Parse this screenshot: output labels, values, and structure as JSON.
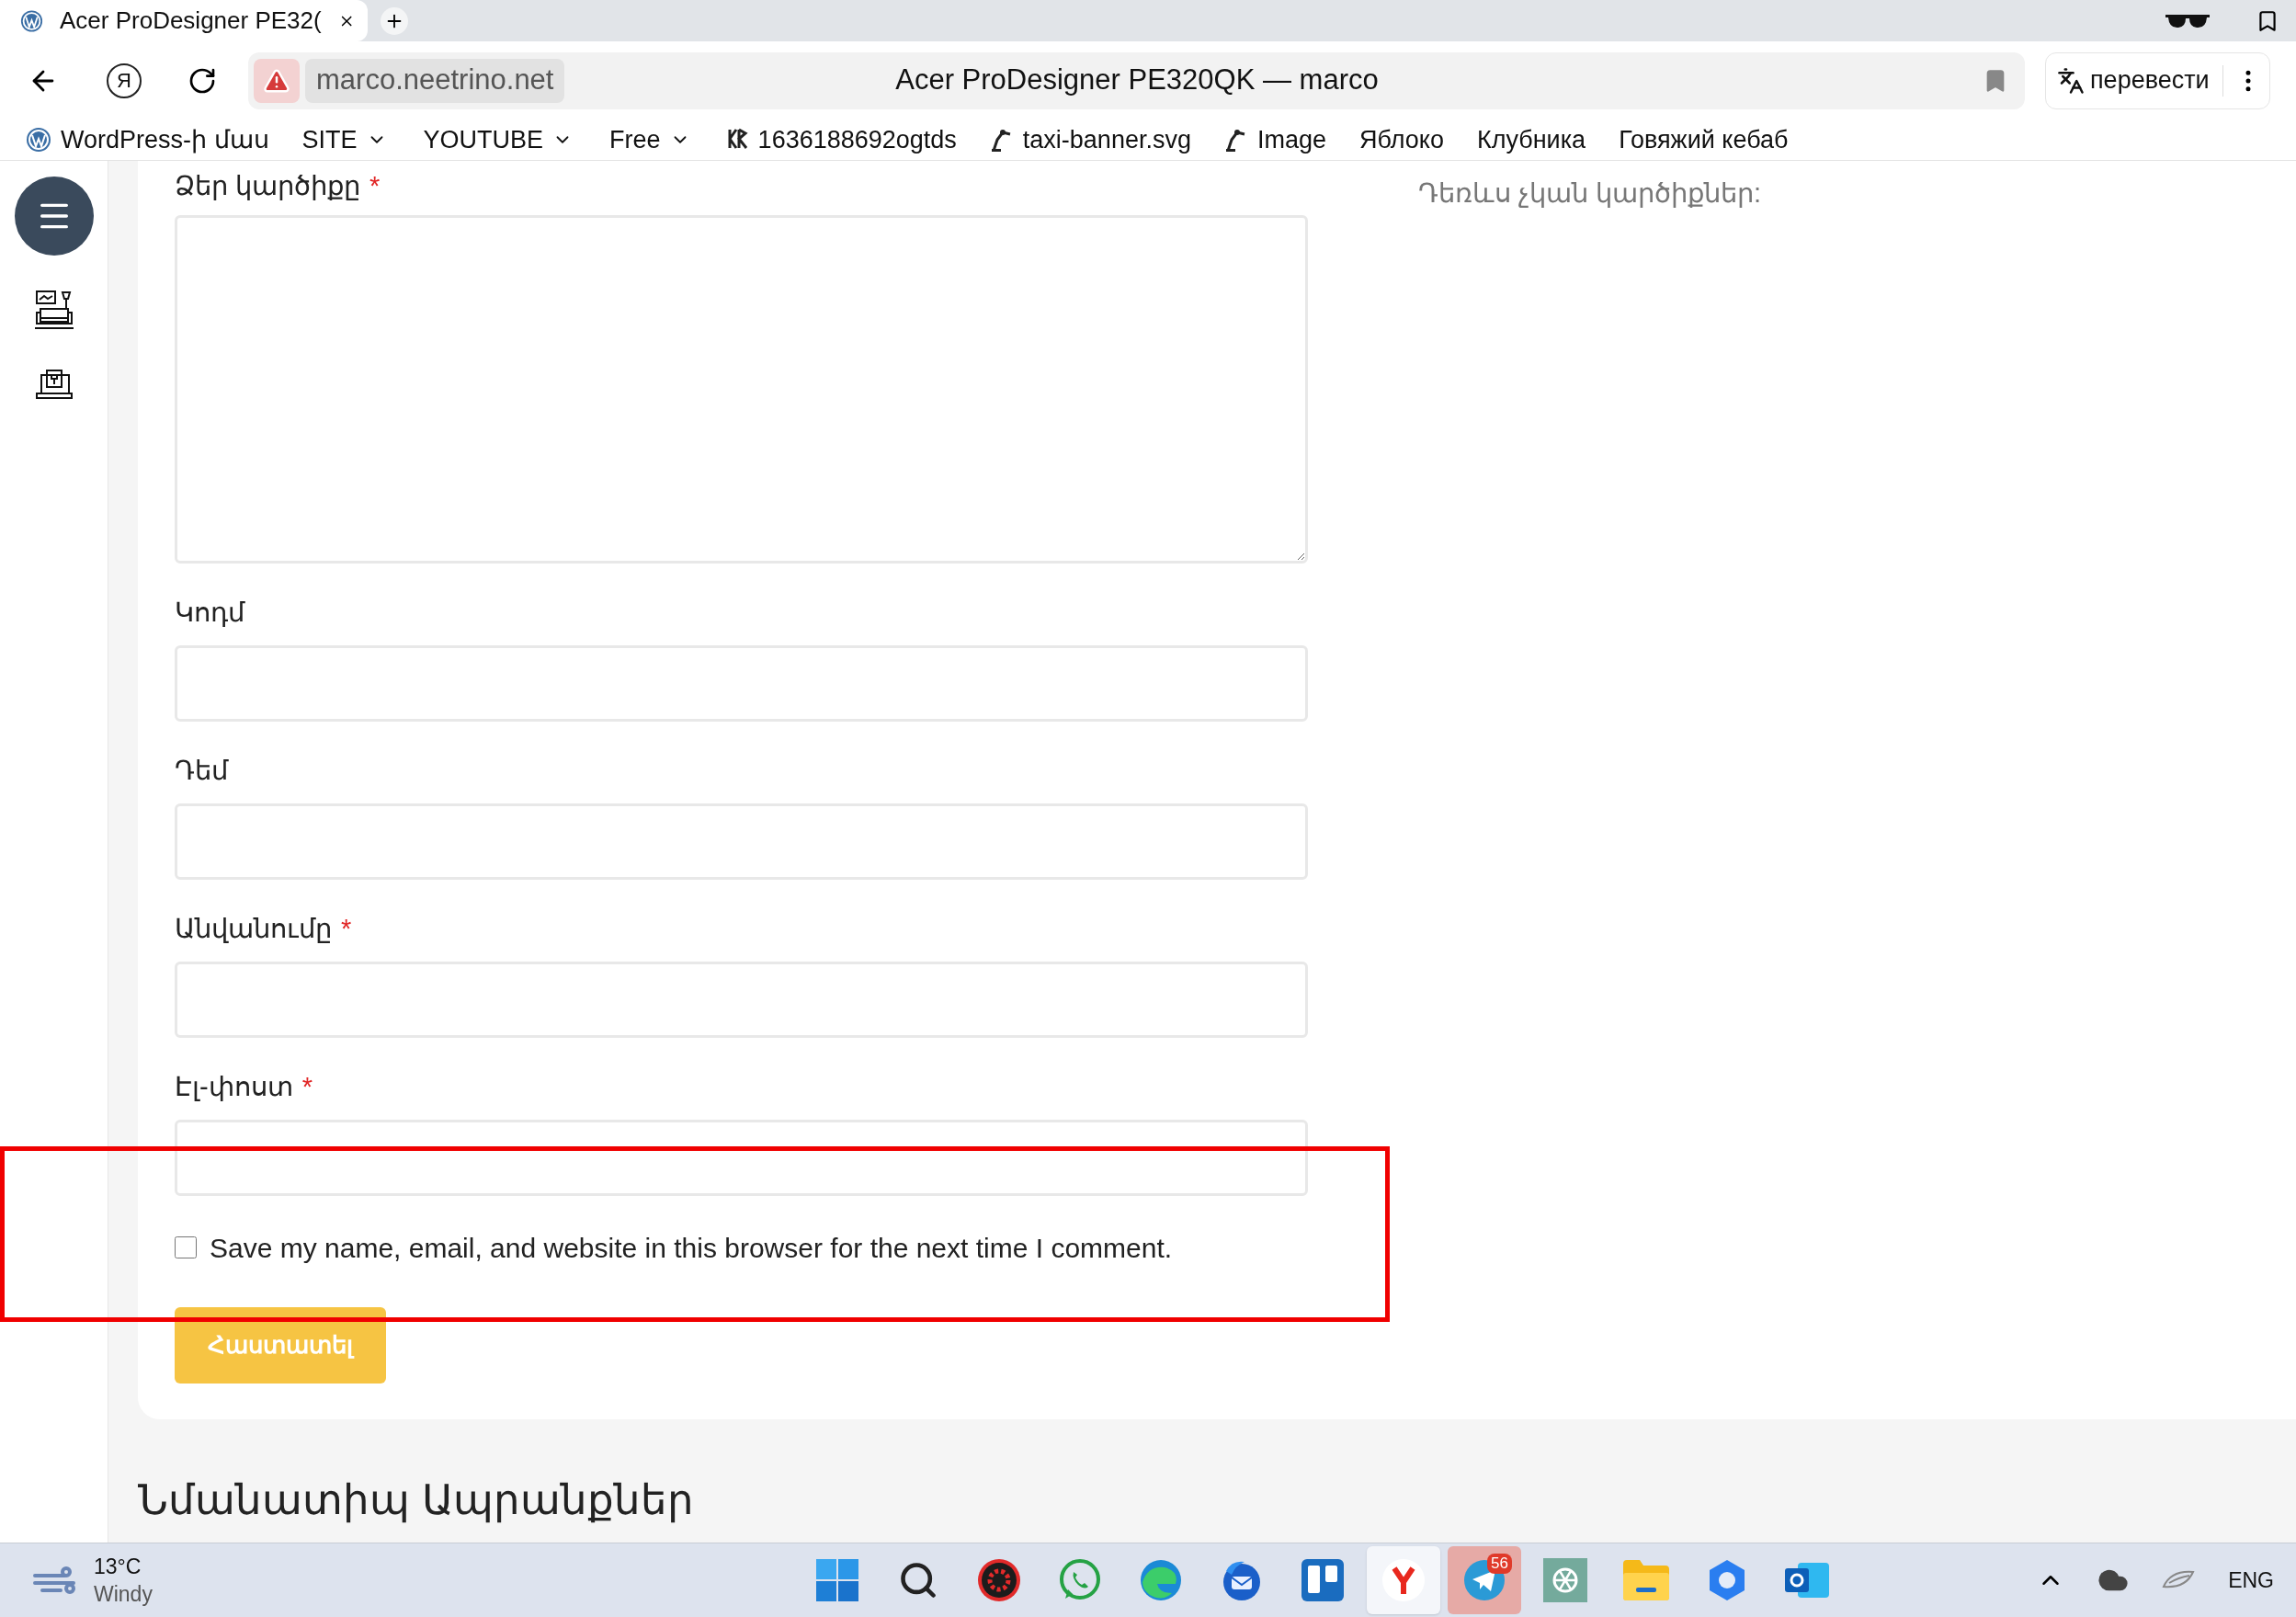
{
  "browser": {
    "tab": {
      "title": "Acer ProDesigner PE32(",
      "selected": true
    },
    "home_label": "Я",
    "address": "marco.neetrino.net",
    "page_title": "Acer ProDesigner PE320QK — marco",
    "translate": "перевести"
  },
  "bookmarks": [
    {
      "label": "WordPress-ի մաս",
      "kind": "wordpress"
    },
    {
      "label": "SITE",
      "kind": "folder"
    },
    {
      "label": "YOUTUBE",
      "kind": "folder"
    },
    {
      "label": "Free",
      "kind": "folder"
    },
    {
      "label": "1636188692ogtds",
      "kind": "logo"
    },
    {
      "label": "taxi-banner.svg",
      "kind": "robot"
    },
    {
      "label": "Image",
      "kind": "robot"
    },
    {
      "label": "Яблоко",
      "kind": "plain"
    },
    {
      "label": "Клубника",
      "kind": "plain"
    },
    {
      "label": "Говяжий кебаб",
      "kind": "plain"
    }
  ],
  "form": {
    "required_mark": "*",
    "fields": [
      {
        "label": "Ձեր կարծիքը",
        "required": true,
        "kind": "textarea"
      },
      {
        "label": "Կոդմ",
        "required": false,
        "kind": "input"
      },
      {
        "label": "Դեմ",
        "required": false,
        "kind": "input"
      },
      {
        "label": "Անվանումը",
        "required": true,
        "kind": "input"
      },
      {
        "label": "Էլ-փոստ",
        "required": true,
        "kind": "input"
      }
    ],
    "consent": {
      "label": "Save my name, email, and website in this browser for the next time I comment.",
      "checked": false
    },
    "submit": "Հաստատել"
  },
  "reviews_empty": "Դեռևս չկան կարծիքներ:",
  "related_heading": "Նմանատիպ Ապրանքներ",
  "taskbar": {
    "weather": {
      "temperature": "13°C",
      "condition": "Windy"
    },
    "apps": [
      {
        "kind": "start",
        "active": false,
        "attention": false
      },
      {
        "kind": "search",
        "active": false,
        "attention": false
      },
      {
        "kind": "redgear",
        "active": false,
        "attention": false
      },
      {
        "kind": "whatsapp",
        "active": false,
        "attention": false
      },
      {
        "kind": "edge",
        "active": false,
        "attention": false
      },
      {
        "kind": "thunderbird",
        "active": false,
        "attention": false
      },
      {
        "kind": "trello",
        "active": false,
        "attention": false
      },
      {
        "kind": "yandex",
        "active": true,
        "attention": false
      },
      {
        "kind": "telegram",
        "active": false,
        "attention": true,
        "badge": "56"
      },
      {
        "kind": "chatgpt",
        "active": false,
        "attention": false
      },
      {
        "kind": "folder",
        "active": false,
        "attention": false
      },
      {
        "kind": "hub",
        "active": false,
        "attention": false
      },
      {
        "kind": "outlook",
        "active": false,
        "attention": false
      }
    ],
    "language": "ENG"
  }
}
